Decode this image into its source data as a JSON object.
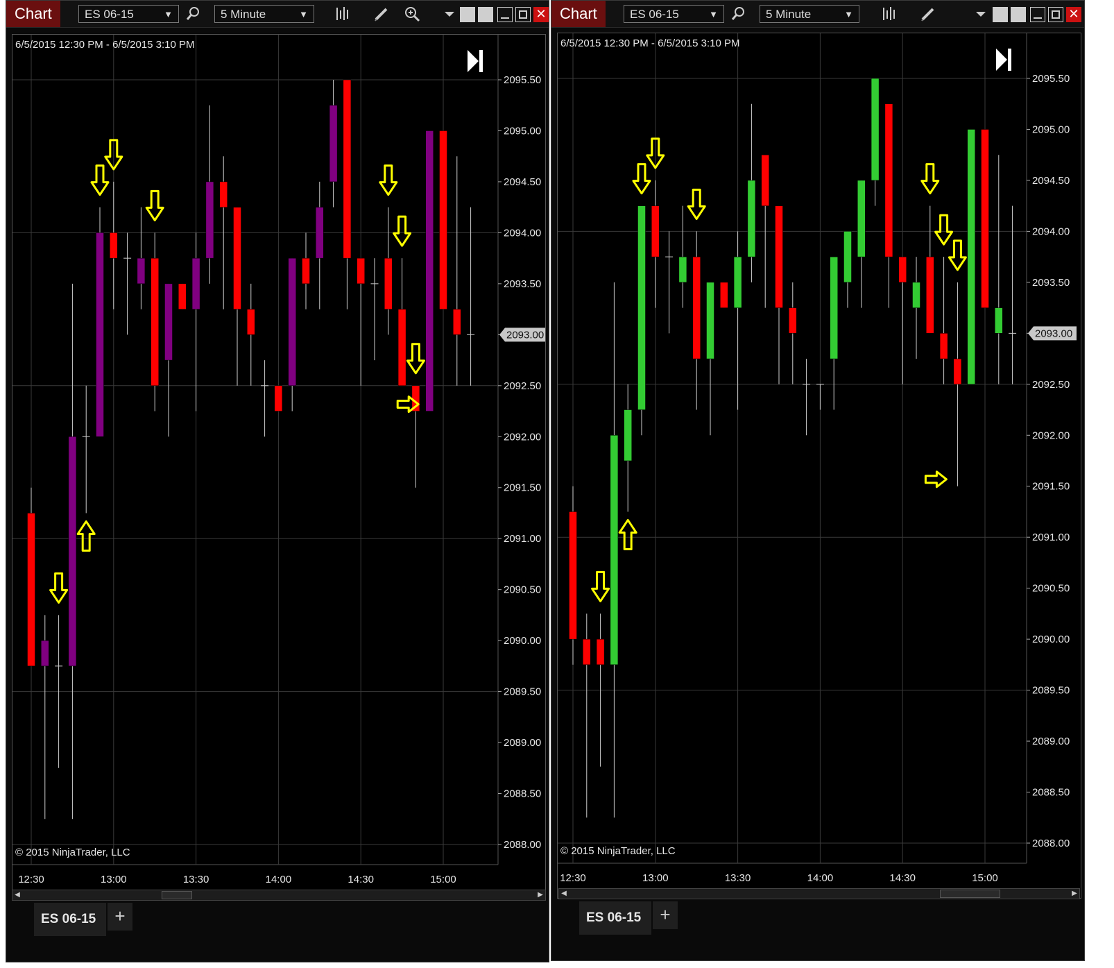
{
  "windows": [
    {
      "title": "Chart",
      "instrument": "ES 06-15",
      "interval": "5 Minute",
      "date_range": "6/5/2015 12:30 PM - 6/5/2015 3:10 PM",
      "copyright": "© 2015 NinjaTrader, LLC",
      "tab_label": "ES 06-15",
      "add_tab_label": "+",
      "y_tick_labels": [
        "2095.50",
        "2095.00",
        "2094.50",
        "2094.00",
        "2093.50",
        "2093.00",
        "2092.50",
        "2092.00",
        "2091.50",
        "2091.00",
        "2090.50",
        "2090.00",
        "2089.50",
        "2089.00",
        "2088.50",
        "2088.00"
      ],
      "x_tick_labels": [
        "12:30",
        "13:00",
        "13:30",
        "14:00",
        "14:30",
        "15:00"
      ],
      "last_price": "2093.00",
      "colors": {
        "up": "#800080",
        "down": "#ff0000",
        "wick": "#cfcfcf",
        "arrow": "#ffff00"
      },
      "scroll_thumb_fraction": [
        0.27,
        0.33
      ],
      "candles": [
        {
          "time": "12:30",
          "open": 2091.25,
          "high": 2091.5,
          "low": 2089.75,
          "close": 2089.75
        },
        {
          "time": "12:35",
          "open": 2089.75,
          "high": 2090.25,
          "low": 2088.25,
          "close": 2090.0
        },
        {
          "time": "12:40",
          "open": 2089.75,
          "high": 2090.25,
          "low": 2088.75,
          "close": 2089.75
        },
        {
          "time": "12:45",
          "open": 2089.75,
          "high": 2093.5,
          "low": 2088.25,
          "close": 2092.0
        },
        {
          "time": "12:50",
          "open": 2092.0,
          "high": 2092.5,
          "low": 2091.25,
          "close": 2092.0
        },
        {
          "time": "12:55",
          "open": 2092.0,
          "high": 2094.25,
          "low": 2092.0,
          "close": 2094.0
        },
        {
          "time": "13:00",
          "open": 2094.0,
          "high": 2094.5,
          "low": 2093.25,
          "close": 2093.75
        },
        {
          "time": "13:05",
          "open": 2093.75,
          "high": 2094.0,
          "low": 2093.0,
          "close": 2093.75
        },
        {
          "time": "13:10",
          "open": 2093.5,
          "high": 2094.25,
          "low": 2093.25,
          "close": 2093.75
        },
        {
          "time": "13:15",
          "open": 2093.75,
          "high": 2094.0,
          "low": 2092.25,
          "close": 2092.5
        },
        {
          "time": "13:20",
          "open": 2092.75,
          "high": 2093.5,
          "low": 2092.0,
          "close": 2093.5
        },
        {
          "time": "13:25",
          "open": 2093.5,
          "high": 2093.5,
          "low": 2093.25,
          "close": 2093.25
        },
        {
          "time": "13:30",
          "open": 2093.25,
          "high": 2094.0,
          "low": 2092.25,
          "close": 2093.75
        },
        {
          "time": "13:35",
          "open": 2093.75,
          "high": 2095.25,
          "low": 2093.5,
          "close": 2094.5
        },
        {
          "time": "13:40",
          "open": 2094.5,
          "high": 2094.75,
          "low": 2093.25,
          "close": 2094.25
        },
        {
          "time": "13:45",
          "open": 2094.25,
          "high": 2094.25,
          "low": 2092.5,
          "close": 2093.25
        },
        {
          "time": "13:50",
          "open": 2093.25,
          "high": 2093.5,
          "low": 2092.5,
          "close": 2093.0
        },
        {
          "time": "13:55",
          "open": 2092.5,
          "high": 2092.75,
          "low": 2092.0,
          "close": 2092.5
        },
        {
          "time": "14:00",
          "open": 2092.5,
          "high": 2092.5,
          "low": 2092.25,
          "close": 2092.25
        },
        {
          "time": "14:05",
          "open": 2092.5,
          "high": 2093.75,
          "low": 2092.25,
          "close": 2093.75
        },
        {
          "time": "14:10",
          "open": 2093.75,
          "high": 2094.0,
          "low": 2093.25,
          "close": 2093.5
        },
        {
          "time": "14:15",
          "open": 2093.75,
          "high": 2094.5,
          "low": 2093.25,
          "close": 2094.25
        },
        {
          "time": "14:20",
          "open": 2094.5,
          "high": 2095.5,
          "low": 2094.25,
          "close": 2095.25
        },
        {
          "time": "14:25",
          "open": 2095.5,
          "high": 2095.5,
          "low": 2093.25,
          "close": 2093.75
        },
        {
          "time": "14:30",
          "open": 2093.75,
          "high": 2093.75,
          "low": 2092.5,
          "close": 2093.5
        },
        {
          "time": "14:35",
          "open": 2093.5,
          "high": 2093.75,
          "low": 2092.75,
          "close": 2093.5
        },
        {
          "time": "14:40",
          "open": 2093.75,
          "high": 2094.25,
          "low": 2093.0,
          "close": 2093.25
        },
        {
          "time": "14:45",
          "open": 2093.25,
          "high": 2093.75,
          "low": 2092.5,
          "close": 2092.5
        },
        {
          "time": "14:50",
          "open": 2092.5,
          "high": 2092.5,
          "low": 2091.5,
          "close": 2092.25
        },
        {
          "time": "14:55",
          "open": 2092.25,
          "high": 2095.0,
          "low": 2092.25,
          "close": 2095.0
        },
        {
          "time": "15:00",
          "open": 2095.0,
          "high": 2095.0,
          "low": 2093.25,
          "close": 2093.25
        },
        {
          "time": "15:05",
          "open": 2093.25,
          "high": 2094.75,
          "low": 2092.5,
          "close": 2093.0
        },
        {
          "time": "15:10",
          "open": 2093.0,
          "high": 2094.25,
          "low": 2092.5,
          "close": 2093.0
        }
      ],
      "arrows": [
        {
          "candle": 2,
          "dir": "down"
        },
        {
          "candle": 4,
          "dir": "up"
        },
        {
          "candle": 5,
          "dir": "down"
        },
        {
          "candle": 6,
          "dir": "down"
        },
        {
          "candle": 9,
          "dir": "down"
        },
        {
          "candle": 26,
          "dir": "down"
        },
        {
          "candle": 27,
          "dir": "down"
        },
        {
          "candle": 28,
          "dir": "down"
        },
        {
          "candle": 29,
          "dir": "right"
        }
      ]
    },
    {
      "title": "Chart",
      "instrument": "ES 06-15",
      "interval": "5 Minute",
      "date_range": "6/5/2015 12:30 PM - 6/5/2015 3:10 PM",
      "copyright": "© 2015 NinjaTrader, LLC",
      "tab_label": "ES 06-15",
      "add_tab_label": "+",
      "y_tick_labels": [
        "2095.50",
        "2095.00",
        "2094.50",
        "2094.00",
        "2093.50",
        "2093.00",
        "2092.50",
        "2092.00",
        "2091.50",
        "2091.00",
        "2090.50",
        "2090.00",
        "2089.50",
        "2089.00",
        "2088.50",
        "2088.00"
      ],
      "x_tick_labels": [
        "12:30",
        "13:00",
        "13:30",
        "14:00",
        "14:30",
        "15:00"
      ],
      "last_price": "2093.00",
      "colors": {
        "up": "#33cc33",
        "down": "#ff0000",
        "wick": "#cfcfcf",
        "arrow": "#ffff00"
      },
      "scroll_thumb_fraction": [
        0.74,
        0.86
      ],
      "candles": [
        {
          "time": "12:30",
          "open": 2091.25,
          "high": 2091.5,
          "low": 2089.75,
          "close": 2090.0
        },
        {
          "time": "12:35",
          "open": 2090.0,
          "high": 2090.25,
          "low": 2088.25,
          "close": 2089.75
        },
        {
          "time": "12:40",
          "open": 2090.0,
          "high": 2090.25,
          "low": 2088.75,
          "close": 2089.75
        },
        {
          "time": "12:45",
          "open": 2089.75,
          "high": 2093.5,
          "low": 2088.25,
          "close": 2092.0
        },
        {
          "time": "12:50",
          "open": 2091.75,
          "high": 2092.5,
          "low": 2091.25,
          "close": 2092.25
        },
        {
          "time": "12:55",
          "open": 2092.25,
          "high": 2094.25,
          "low": 2092.0,
          "close": 2094.25
        },
        {
          "time": "13:00",
          "open": 2094.25,
          "high": 2094.5,
          "low": 2093.25,
          "close": 2093.75
        },
        {
          "time": "13:05",
          "open": 2093.75,
          "high": 2094.0,
          "low": 2093.0,
          "close": 2093.75
        },
        {
          "time": "13:10",
          "open": 2093.5,
          "high": 2094.25,
          "low": 2093.25,
          "close": 2093.75
        },
        {
          "time": "13:15",
          "open": 2093.75,
          "high": 2094.0,
          "low": 2092.25,
          "close": 2092.75
        },
        {
          "time": "13:20",
          "open": 2092.75,
          "high": 2093.5,
          "low": 2092.0,
          "close": 2093.5
        },
        {
          "time": "13:25",
          "open": 2093.5,
          "high": 2093.5,
          "low": 2093.25,
          "close": 2093.25
        },
        {
          "time": "13:30",
          "open": 2093.25,
          "high": 2094.0,
          "low": 2092.25,
          "close": 2093.75
        },
        {
          "time": "13:35",
          "open": 2093.75,
          "high": 2095.25,
          "low": 2093.5,
          "close": 2094.5
        },
        {
          "time": "13:40",
          "open": 2094.75,
          "high": 2094.75,
          "low": 2093.25,
          "close": 2094.25
        },
        {
          "time": "13:45",
          "open": 2094.25,
          "high": 2094.25,
          "low": 2092.5,
          "close": 2093.25
        },
        {
          "time": "13:50",
          "open": 2093.25,
          "high": 2093.5,
          "low": 2092.5,
          "close": 2093.0
        },
        {
          "time": "13:55",
          "open": 2092.5,
          "high": 2092.75,
          "low": 2092.0,
          "close": 2092.5
        },
        {
          "time": "14:00",
          "open": 2092.5,
          "high": 2092.5,
          "low": 2092.25,
          "close": 2092.5
        },
        {
          "time": "14:05",
          "open": 2092.75,
          "high": 2093.75,
          "low": 2092.25,
          "close": 2093.75
        },
        {
          "time": "14:10",
          "open": 2093.5,
          "high": 2094.0,
          "low": 2093.25,
          "close": 2094.0
        },
        {
          "time": "14:15",
          "open": 2093.75,
          "high": 2094.5,
          "low": 2093.25,
          "close": 2094.5
        },
        {
          "time": "14:20",
          "open": 2094.5,
          "high": 2095.5,
          "low": 2094.25,
          "close": 2095.5
        },
        {
          "time": "14:25",
          "open": 2095.25,
          "high": 2095.25,
          "low": 2093.25,
          "close": 2093.75
        },
        {
          "time": "14:30",
          "open": 2093.75,
          "high": 2093.75,
          "low": 2092.5,
          "close": 2093.5
        },
        {
          "time": "14:35",
          "open": 2093.25,
          "high": 2093.75,
          "low": 2092.75,
          "close": 2093.5
        },
        {
          "time": "14:40",
          "open": 2093.75,
          "high": 2094.25,
          "low": 2093.0,
          "close": 2093.0
        },
        {
          "time": "14:45",
          "open": 2093.0,
          "high": 2093.75,
          "low": 2092.5,
          "close": 2092.75
        },
        {
          "time": "14:50",
          "open": 2092.75,
          "high": 2093.5,
          "low": 2091.5,
          "close": 2092.5
        },
        {
          "time": "14:55",
          "open": 2092.5,
          "high": 2095.0,
          "low": 2092.5,
          "close": 2095.0
        },
        {
          "time": "15:00",
          "open": 2095.0,
          "high": 2095.0,
          "low": 2093.25,
          "close": 2093.25
        },
        {
          "time": "15:05",
          "open": 2093.0,
          "high": 2094.75,
          "low": 2092.5,
          "close": 2093.25
        },
        {
          "time": "15:10",
          "open": 2093.0,
          "high": 2094.25,
          "low": 2092.5,
          "close": 2093.0
        }
      ],
      "arrows": [
        {
          "candle": 2,
          "dir": "down"
        },
        {
          "candle": 4,
          "dir": "up"
        },
        {
          "candle": 5,
          "dir": "down"
        },
        {
          "candle": 6,
          "dir": "down"
        },
        {
          "candle": 9,
          "dir": "down"
        },
        {
          "candle": 26,
          "dir": "down"
        },
        {
          "candle": 27,
          "dir": "down"
        },
        {
          "candle": 28,
          "dir": "down"
        },
        {
          "candle": 28,
          "dir": "right"
        }
      ]
    }
  ],
  "chart_data": [
    {
      "type": "candlestick",
      "title": "ES 06-15 5 Minute",
      "x_label": "",
      "y_label": "",
      "ylim": [
        2088.0,
        2095.75
      ],
      "series": [
        {
          "name": "ES 06-15",
          "values_ref": "windows.0.candles"
        }
      ],
      "grid": true
    },
    {
      "type": "candlestick",
      "title": "ES 06-15 5 Minute",
      "x_label": "",
      "y_label": "",
      "ylim": [
        2088.0,
        2095.75
      ],
      "series": [
        {
          "name": "ES 06-15",
          "values_ref": "windows.1.candles"
        }
      ],
      "grid": true
    }
  ]
}
